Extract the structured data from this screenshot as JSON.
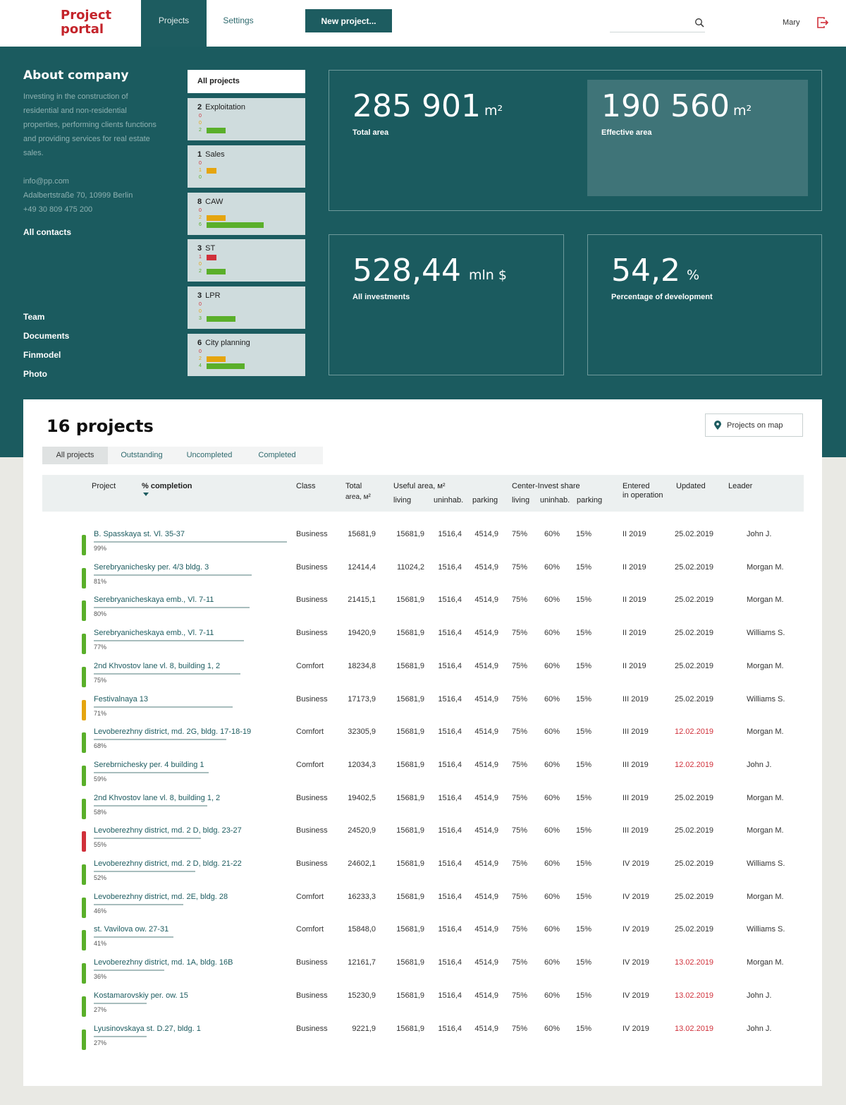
{
  "header": {
    "logo_line1": "Project",
    "logo_line2": "portal",
    "tab_projects": "Projects",
    "tab_settings": "Settings",
    "new_project": "New project...",
    "search_placeholder": "",
    "user_name": "Mary"
  },
  "about": {
    "title": "About company",
    "description": "Investing in the construction of residential and non-residential properties, performing clients functions and providing services for real estate sales.",
    "email": "info@pp.com",
    "address": "Adalbertstraße 70, 10999 Berlin",
    "phone": "+49 30 809 475 200",
    "all_contacts": "All contacts",
    "links": [
      "Team",
      "Documents",
      "Finmodel",
      "Photo"
    ]
  },
  "filters": {
    "all_projects": "All projects",
    "categories": [
      {
        "count": "2",
        "name": "Exploitation",
        "red": 0,
        "yellow": 0,
        "green": 2
      },
      {
        "count": "1",
        "name": "Sales",
        "red": 0,
        "yellow": 1,
        "green": 0
      },
      {
        "count": "8",
        "name": "CAW",
        "red": 0,
        "yellow": 2,
        "green": 6
      },
      {
        "count": "3",
        "name": "ST",
        "red": 1,
        "yellow": 0,
        "green": 2
      },
      {
        "count": "3",
        "name": "LPR",
        "red": 0,
        "yellow": 0,
        "green": 3
      },
      {
        "count": "6",
        "name": "City planning",
        "red": 0,
        "yellow": 2,
        "green": 4
      }
    ]
  },
  "stats": {
    "total_area": {
      "value": "285 901",
      "unit": "m²",
      "label": "Total area"
    },
    "effective_area": {
      "value": "190 560",
      "unit": "m²",
      "label": "Effective area"
    },
    "investments": {
      "value": "528,44",
      "unit": "mln $",
      "label": "All investments"
    },
    "development": {
      "value": "54,2",
      "unit": "%",
      "label": "Percentage of development"
    }
  },
  "projects_panel": {
    "title": "16 projects",
    "map_button": "Projects on map",
    "tabs": [
      "All projects",
      "Outstanding",
      "Uncompleted",
      "Completed"
    ],
    "columns": {
      "project": "Project",
      "completion": "% completion",
      "class": "Class",
      "total_area_1": "Total",
      "total_area_2": "area, м²",
      "useful_area": "Useful area, м²",
      "living": "living",
      "uninhab": "uninhab.",
      "parking": "parking",
      "share": "Center-Invest share",
      "share_living": "living",
      "share_uninhab": "uninhab.",
      "share_parking": "parking",
      "entered_1": "Entered",
      "entered_2": "in operation",
      "updated": "Updated",
      "leader": "Leader"
    },
    "rows": [
      {
        "name": "B. Spasskaya st. Vl. 35-37",
        "pct": "99%",
        "completion": 99,
        "status": "#5aaf2a",
        "class": "Business",
        "total": "15681,9",
        "living": "15681,9",
        "uninhab": "1516,4",
        "parking": "4514,9",
        "s_living": "75%",
        "s_uninhab": "60%",
        "s_parking": "15%",
        "entered": "II 2019",
        "updated": "25.02.2019",
        "updated_red": false,
        "leader": "John J."
      },
      {
        "name": "Serebryanichesky per. 4/3 bldg. 3",
        "pct": "81%",
        "completion": 81,
        "status": "#5aaf2a",
        "class": "Business",
        "total": "12414,4",
        "living": "11024,2",
        "uninhab": "1516,4",
        "parking": "4514,9",
        "s_living": "75%",
        "s_uninhab": "60%",
        "s_parking": "15%",
        "entered": "II 2019",
        "updated": "25.02.2019",
        "updated_red": false,
        "leader": "Morgan M."
      },
      {
        "name": "Serebryanicheskaya emb., Vl. 7-11",
        "pct": "80%",
        "completion": 80,
        "status": "#5aaf2a",
        "class": "Business",
        "total": "21415,1",
        "living": "15681,9",
        "uninhab": "1516,4",
        "parking": "4514,9",
        "s_living": "75%",
        "s_uninhab": "60%",
        "s_parking": "15%",
        "entered": "II 2019",
        "updated": "25.02.2019",
        "updated_red": false,
        "leader": "Morgan M."
      },
      {
        "name": "Serebryanicheskaya emb., Vl. 7-11",
        "pct": "77%",
        "completion": 77,
        "status": "#5aaf2a",
        "class": "Business",
        "total": "19420,9",
        "living": "15681,9",
        "uninhab": "1516,4",
        "parking": "4514,9",
        "s_living": "75%",
        "s_uninhab": "60%",
        "s_parking": "15%",
        "entered": "II 2019",
        "updated": "25.02.2019",
        "updated_red": false,
        "leader": "Williams S."
      },
      {
        "name": "2nd Khvostov lane vl. 8, building 1, 2",
        "pct": "75%",
        "completion": 75,
        "status": "#5aaf2a",
        "class": "Comfort",
        "total": "18234,8",
        "living": "15681,9",
        "uninhab": "1516,4",
        "parking": "4514,9",
        "s_living": "75%",
        "s_uninhab": "60%",
        "s_parking": "15%",
        "entered": "II 2019",
        "updated": "25.02.2019",
        "updated_red": false,
        "leader": "Morgan M."
      },
      {
        "name": "Festivalnaya 13",
        "pct": "71%",
        "completion": 71,
        "status": "#e5a50f",
        "class": "Business",
        "total": "17173,9",
        "living": "15681,9",
        "uninhab": "1516,4",
        "parking": "4514,9",
        "s_living": "75%",
        "s_uninhab": "60%",
        "s_parking": "15%",
        "entered": "III 2019",
        "updated": "25.02.2019",
        "updated_red": false,
        "leader": "Williams S."
      },
      {
        "name": "Levoberezhny district, md. 2G, bldg. 17-18-19",
        "pct": "68%",
        "completion": 68,
        "status": "#5aaf2a",
        "class": "Comfort",
        "total": "32305,9",
        "living": "15681,9",
        "uninhab": "1516,4",
        "parking": "4514,9",
        "s_living": "75%",
        "s_uninhab": "60%",
        "s_parking": "15%",
        "entered": "III 2019",
        "updated": "12.02.2019",
        "updated_red": true,
        "leader": "Morgan M."
      },
      {
        "name": "Serebrnichesky per. 4 building 1",
        "pct": "59%",
        "completion": 59,
        "status": "#5aaf2a",
        "class": "Comfort",
        "total": "12034,3",
        "living": "15681,9",
        "uninhab": "1516,4",
        "parking": "4514,9",
        "s_living": "75%",
        "s_uninhab": "60%",
        "s_parking": "15%",
        "entered": "III 2019",
        "updated": "12.02.2019",
        "updated_red": true,
        "leader": "John J."
      },
      {
        "name": "2nd Khvostov lane vl. 8, building 1, 2",
        "pct": "58%",
        "completion": 58,
        "status": "#5aaf2a",
        "class": "Business",
        "total": "19402,5",
        "living": "15681,9",
        "uninhab": "1516,4",
        "parking": "4514,9",
        "s_living": "75%",
        "s_uninhab": "60%",
        "s_parking": "15%",
        "entered": "III 2019",
        "updated": "25.02.2019",
        "updated_red": false,
        "leader": "Morgan M."
      },
      {
        "name": "Levoberezhny district, md. 2 D, bldg. 23-27",
        "pct": "55%",
        "completion": 55,
        "status": "#d0303a",
        "class": "Business",
        "total": "24520,9",
        "living": "15681,9",
        "uninhab": "1516,4",
        "parking": "4514,9",
        "s_living": "75%",
        "s_uninhab": "60%",
        "s_parking": "15%",
        "entered": "III 2019",
        "updated": "25.02.2019",
        "updated_red": false,
        "leader": "Morgan M."
      },
      {
        "name": "Levoberezhny district, md. 2 D, bldg. 21-22",
        "pct": "52%",
        "completion": 52,
        "status": "#5aaf2a",
        "class": "Business",
        "total": "24602,1",
        "living": "15681,9",
        "uninhab": "1516,4",
        "parking": "4514,9",
        "s_living": "75%",
        "s_uninhab": "60%",
        "s_parking": "15%",
        "entered": "IV 2019",
        "updated": "25.02.2019",
        "updated_red": false,
        "leader": "Williams S."
      },
      {
        "name": "Levoberezhny district, md. 2E, bldg. 28",
        "pct": "46%",
        "completion": 46,
        "status": "#5aaf2a",
        "class": "Comfort",
        "total": "16233,3",
        "living": "15681,9",
        "uninhab": "1516,4",
        "parking": "4514,9",
        "s_living": "75%",
        "s_uninhab": "60%",
        "s_parking": "15%",
        "entered": "IV 2019",
        "updated": "25.02.2019",
        "updated_red": false,
        "leader": "Morgan M."
      },
      {
        "name": "st. Vavilova ow. 27-31",
        "pct": "41%",
        "completion": 41,
        "status": "#5aaf2a",
        "class": "Comfort",
        "total": "15848,0",
        "living": "15681,9",
        "uninhab": "1516,4",
        "parking": "4514,9",
        "s_living": "75%",
        "s_uninhab": "60%",
        "s_parking": "15%",
        "entered": "IV 2019",
        "updated": "25.02.2019",
        "updated_red": false,
        "leader": "Williams S."
      },
      {
        "name": "Levoberezhny district, md. 1A, bldg. 16B",
        "pct": "36%",
        "completion": 36,
        "status": "#5aaf2a",
        "class": "Business",
        "total": "12161,7",
        "living": "15681,9",
        "uninhab": "1516,4",
        "parking": "4514,9",
        "s_living": "75%",
        "s_uninhab": "60%",
        "s_parking": "15%",
        "entered": "IV 2019",
        "updated": "13.02.2019",
        "updated_red": true,
        "leader": "Morgan M."
      },
      {
        "name": "Kostamarovskiy per. ow. 15",
        "pct": "27%",
        "completion": 27,
        "status": "#5aaf2a",
        "class": "Business",
        "total": "15230,9",
        "living": "15681,9",
        "uninhab": "1516,4",
        "parking": "4514,9",
        "s_living": "75%",
        "s_uninhab": "60%",
        "s_parking": "15%",
        "entered": "IV 2019",
        "updated": "13.02.2019",
        "updated_red": true,
        "leader": "John J."
      },
      {
        "name": "Lyusinovskaya st. D.27, bldg. 1",
        "pct": "27%",
        "completion": 27,
        "status": "#5aaf2a",
        "class": "Business",
        "total": "9221,9",
        "living": "15681,9",
        "uninhab": "1516,4",
        "parking": "4514,9",
        "s_living": "75%",
        "s_uninhab": "60%",
        "s_parking": "15%",
        "entered": "IV 2019",
        "updated": "13.02.2019",
        "updated_red": true,
        "leader": "John J."
      }
    ]
  },
  "colors": {
    "teal": "#1b5b5f",
    "red": "#d0303a",
    "yellow": "#e5a50f",
    "green": "#5aaf2a"
  }
}
